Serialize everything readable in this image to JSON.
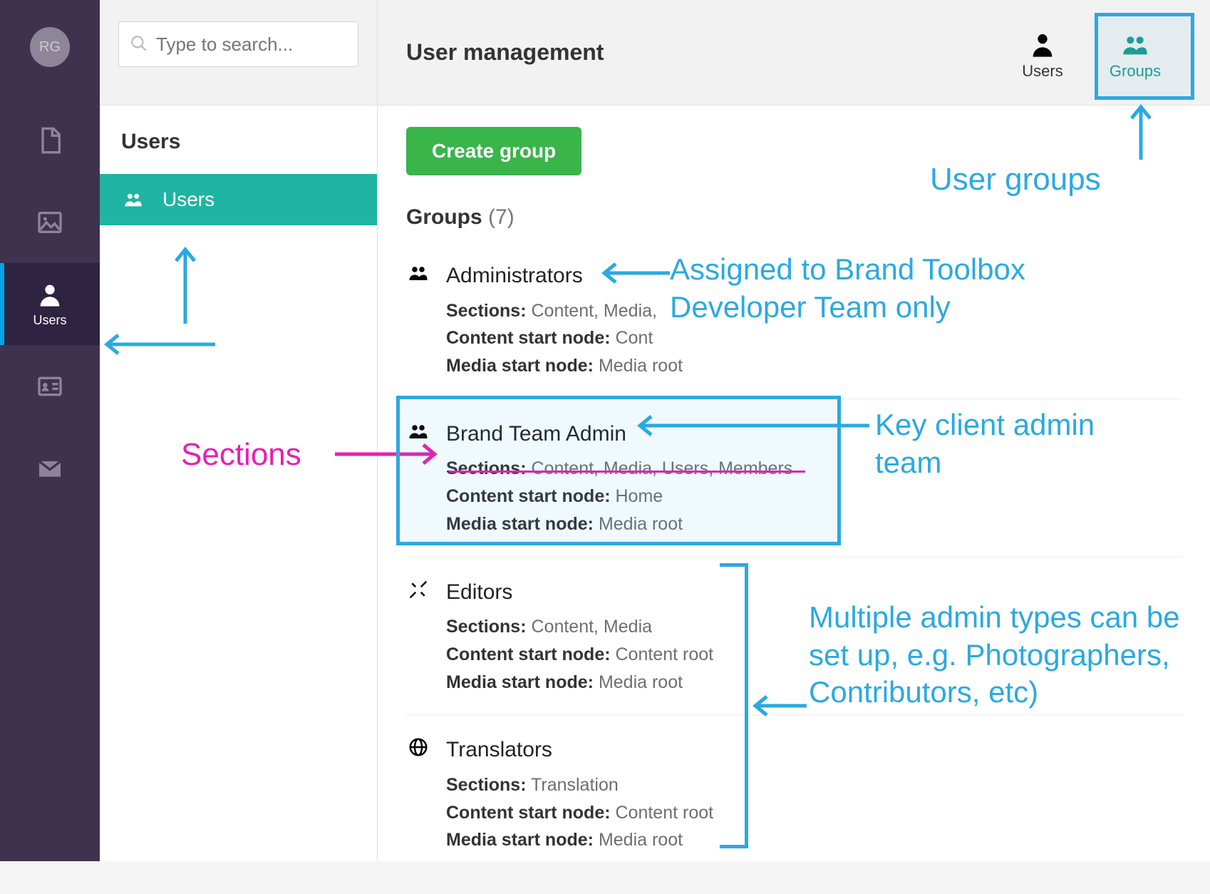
{
  "avatar": {
    "initials": "RG"
  },
  "rail": {
    "active_label": "Users"
  },
  "search": {
    "placeholder": "Type to search..."
  },
  "tree": {
    "title": "Users",
    "item_users": "Users"
  },
  "header": {
    "title": "User management",
    "tab_users": "Users",
    "tab_groups": "Groups"
  },
  "create_button": "Create group",
  "groups_heading": {
    "label": "Groups",
    "count": "(7)"
  },
  "groups": [
    {
      "name": "Administrators",
      "sections_label": "Sections:",
      "sections": "Content, Media,",
      "content_node_label": "Content start node:",
      "content_node": "Cont",
      "media_node_label": "Media start node:",
      "media_node": "Media root"
    },
    {
      "name": "Brand Team Admin",
      "sections_label": "Sections:",
      "sections": "Content, Media, Users, Members",
      "content_node_label": "Content start node:",
      "content_node": "Home",
      "media_node_label": "Media start node:",
      "media_node": "Media root"
    },
    {
      "name": "Editors",
      "sections_label": "Sections:",
      "sections": "Content, Media",
      "content_node_label": "Content start node:",
      "content_node": "Content root",
      "media_node_label": "Media start node:",
      "media_node": "Media root"
    },
    {
      "name": "Translators",
      "sections_label": "Sections:",
      "sections": "Translation",
      "content_node_label": "Content start node:",
      "content_node": "Content root",
      "media_node_label": "Media start node:",
      "media_node": "Media root"
    }
  ],
  "annotations": {
    "user_groups": "User groups",
    "sections": "Sections",
    "administrators": "Assigned to Brand Toolbox Developer Team only",
    "brand_team": "Key client admin team",
    "multi": "Multiple admin types can be set up, e.g. Photographers, Contributors, etc)"
  }
}
